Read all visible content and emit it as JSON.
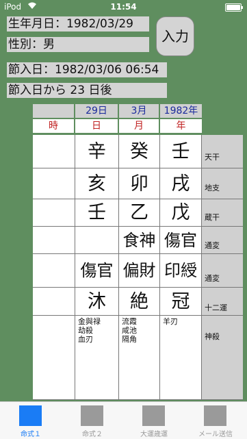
{
  "status": {
    "carrier": "iPod",
    "time": "11:54"
  },
  "info": {
    "birth": "生年月日：1982/03/29",
    "gender": "性別：男",
    "setsu_date": "節入日：1982/03/06 06:54",
    "setsu_after": "節入日から 23 日後",
    "input_button": "入力"
  },
  "header": {
    "day_value": "29日",
    "month_value": "3月",
    "year_value": "1982年",
    "time_label": "時",
    "day_label": "日",
    "month_label": "月",
    "year_label": "年"
  },
  "rows": {
    "tenkan": {
      "label": "天干",
      "day": "辛",
      "month": "癸",
      "year": "壬"
    },
    "chishi": {
      "label": "地支",
      "day": "亥",
      "month": "卯",
      "year": "戌"
    },
    "zoukan": {
      "label": "蔵干",
      "day": "壬",
      "month": "乙",
      "year": "戊"
    },
    "tsuhen1": {
      "label": "通変",
      "day": "",
      "month": "食神",
      "year": "傷官"
    },
    "tsuhen2": {
      "label": "通変",
      "day": "傷官",
      "month": "偏財",
      "year": "印綬"
    },
    "juniun": {
      "label": "十二運",
      "day": "沐",
      "month": "絶",
      "year": "冠"
    },
    "shinsatsu": {
      "label": "神殺",
      "day": [
        "金與禄",
        "劫殺",
        "血刃"
      ],
      "month": [
        "流霞",
        "咸池",
        "隔角"
      ],
      "year": [
        "羊刃"
      ]
    }
  },
  "tabs": [
    {
      "label": "命式１",
      "active": true
    },
    {
      "label": "命式２",
      "active": false
    },
    {
      "label": "大運歳運",
      "active": false
    },
    {
      "label": "メール送信",
      "active": false
    }
  ],
  "colors": {
    "background": "#5f8e5f",
    "accent": "#1a7cf5",
    "header_blue": "#1a2a9c",
    "header_red": "#c02020"
  }
}
